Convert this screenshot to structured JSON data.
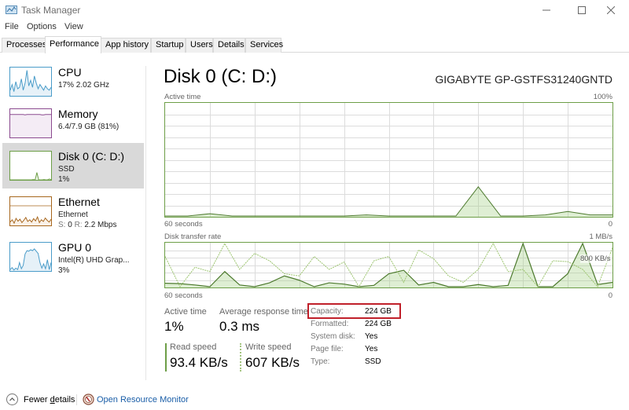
{
  "window": {
    "title": "Task Manager",
    "controls": {
      "minimize": "—",
      "maximize": "☐",
      "close": "✕"
    }
  },
  "menu": [
    "File",
    "Options",
    "View"
  ],
  "tabs": [
    {
      "label": "Processes",
      "active": false
    },
    {
      "label": "Performance",
      "active": true
    },
    {
      "label": "App history",
      "active": false
    },
    {
      "label": "Startup",
      "active": false
    },
    {
      "label": "Users",
      "active": false
    },
    {
      "label": "Details",
      "active": false
    },
    {
      "label": "Services",
      "active": false
    }
  ],
  "sidebar": {
    "items": [
      {
        "title": "CPU",
        "line1": "17% 2.02 GHz",
        "line2": "",
        "color": "#4a9cc9",
        "fill": "#e6f1f8",
        "selected": false
      },
      {
        "title": "Memory",
        "line1": "6.4/7.9 GB (81%)",
        "line2": "",
        "color": "#8b4a8f",
        "fill": "#f4ecf5",
        "selected": false
      },
      {
        "title": "Disk 0 (C: D:)",
        "line1": "SSD",
        "line2": "1%",
        "color": "#6d9e47",
        "fill": "#eef6e8",
        "selected": true
      },
      {
        "title": "Ethernet",
        "line1": "Ethernet",
        "line2_muted_s": "S:",
        "line2_s": "0",
        "line2_muted_r": "R:",
        "line2_r": "2.2 Mbps",
        "color": "#a7671e",
        "fill": "#fbf2e8",
        "selected": false
      },
      {
        "title": "GPU 0",
        "line1": "Intel(R) UHD Grap...",
        "line2": "3%",
        "color": "#4a9cc9",
        "fill": "#e6f1f8",
        "selected": false
      }
    ]
  },
  "main": {
    "title": "Disk 0 (C: D:)",
    "model": "GIGABYTE GP-GSTFS31240GNTD",
    "active_time_graph": {
      "label": "Active time",
      "max_label": "100%",
      "x_label": "60 seconds",
      "min_label": "0"
    },
    "transfer_graph": {
      "label": "Disk transfer rate",
      "max_label": "1 MB/s",
      "mid_label": "800 KB/s",
      "x_label": "60 seconds",
      "min_label": "0"
    },
    "stats": {
      "active_time_label": "Active time",
      "active_time_value": "1%",
      "avg_response_label": "Average response time",
      "avg_response_value": "0.3 ms",
      "read_speed_label": "Read speed",
      "read_speed_value": "93.4 KB/s",
      "write_speed_label": "Write speed",
      "write_speed_value": "607 KB/s"
    },
    "properties": [
      {
        "key": "Capacity:",
        "value": "224 GB"
      },
      {
        "key": "Formatted:",
        "value": "224 GB"
      },
      {
        "key": "System disk:",
        "value": "Yes"
      },
      {
        "key": "Page file:",
        "value": "Yes"
      },
      {
        "key": "Type:",
        "value": "SSD"
      }
    ]
  },
  "footer": {
    "fewer_details": "Fewer details",
    "open_resource_monitor": "Open Resource Monitor"
  },
  "chart_data": [
    {
      "type": "area",
      "title": "Active time",
      "xlabel": "60 seconds",
      "ylabel": "",
      "ylim": [
        0,
        100
      ],
      "y_unit": "%",
      "x": [
        60,
        57,
        54,
        51,
        48,
        45,
        42,
        39,
        36,
        33,
        30,
        27,
        24,
        21,
        18,
        15,
        12,
        9,
        6,
        3,
        0
      ],
      "series": [
        {
          "name": "Active time",
          "values": [
            0,
            0,
            2,
            0,
            0,
            0,
            0,
            0,
            0,
            1,
            0,
            0,
            0,
            0,
            26,
            0,
            0,
            1,
            4,
            1,
            1
          ]
        }
      ]
    },
    {
      "type": "line",
      "title": "Disk transfer rate",
      "xlabel": "60 seconds",
      "ylim": [
        0,
        1000
      ],
      "y_unit": "KB/s",
      "x": [
        60,
        58,
        56,
        54,
        52,
        50,
        48,
        46,
        44,
        42,
        40,
        38,
        36,
        34,
        32,
        30,
        28,
        26,
        24,
        22,
        20,
        18,
        16,
        14,
        12,
        10,
        8,
        6,
        4,
        2,
        0
      ],
      "series": [
        {
          "name": "Read",
          "values": [
            80,
            70,
            40,
            0,
            350,
            40,
            0,
            90,
            250,
            150,
            0,
            90,
            60,
            0,
            30,
            300,
            380,
            40,
            100,
            0,
            0,
            50,
            0,
            30,
            1000,
            0,
            0,
            300,
            1000,
            50,
            100
          ]
        },
        {
          "name": "Write",
          "values": [
            700,
            0,
            450,
            350,
            1000,
            400,
            770,
            600,
            300,
            250,
            700,
            400,
            570,
            0,
            600,
            700,
            100,
            850,
            650,
            250,
            100,
            400,
            1000,
            350,
            400,
            0,
            600,
            580,
            400,
            0,
            900
          ]
        }
      ]
    }
  ]
}
